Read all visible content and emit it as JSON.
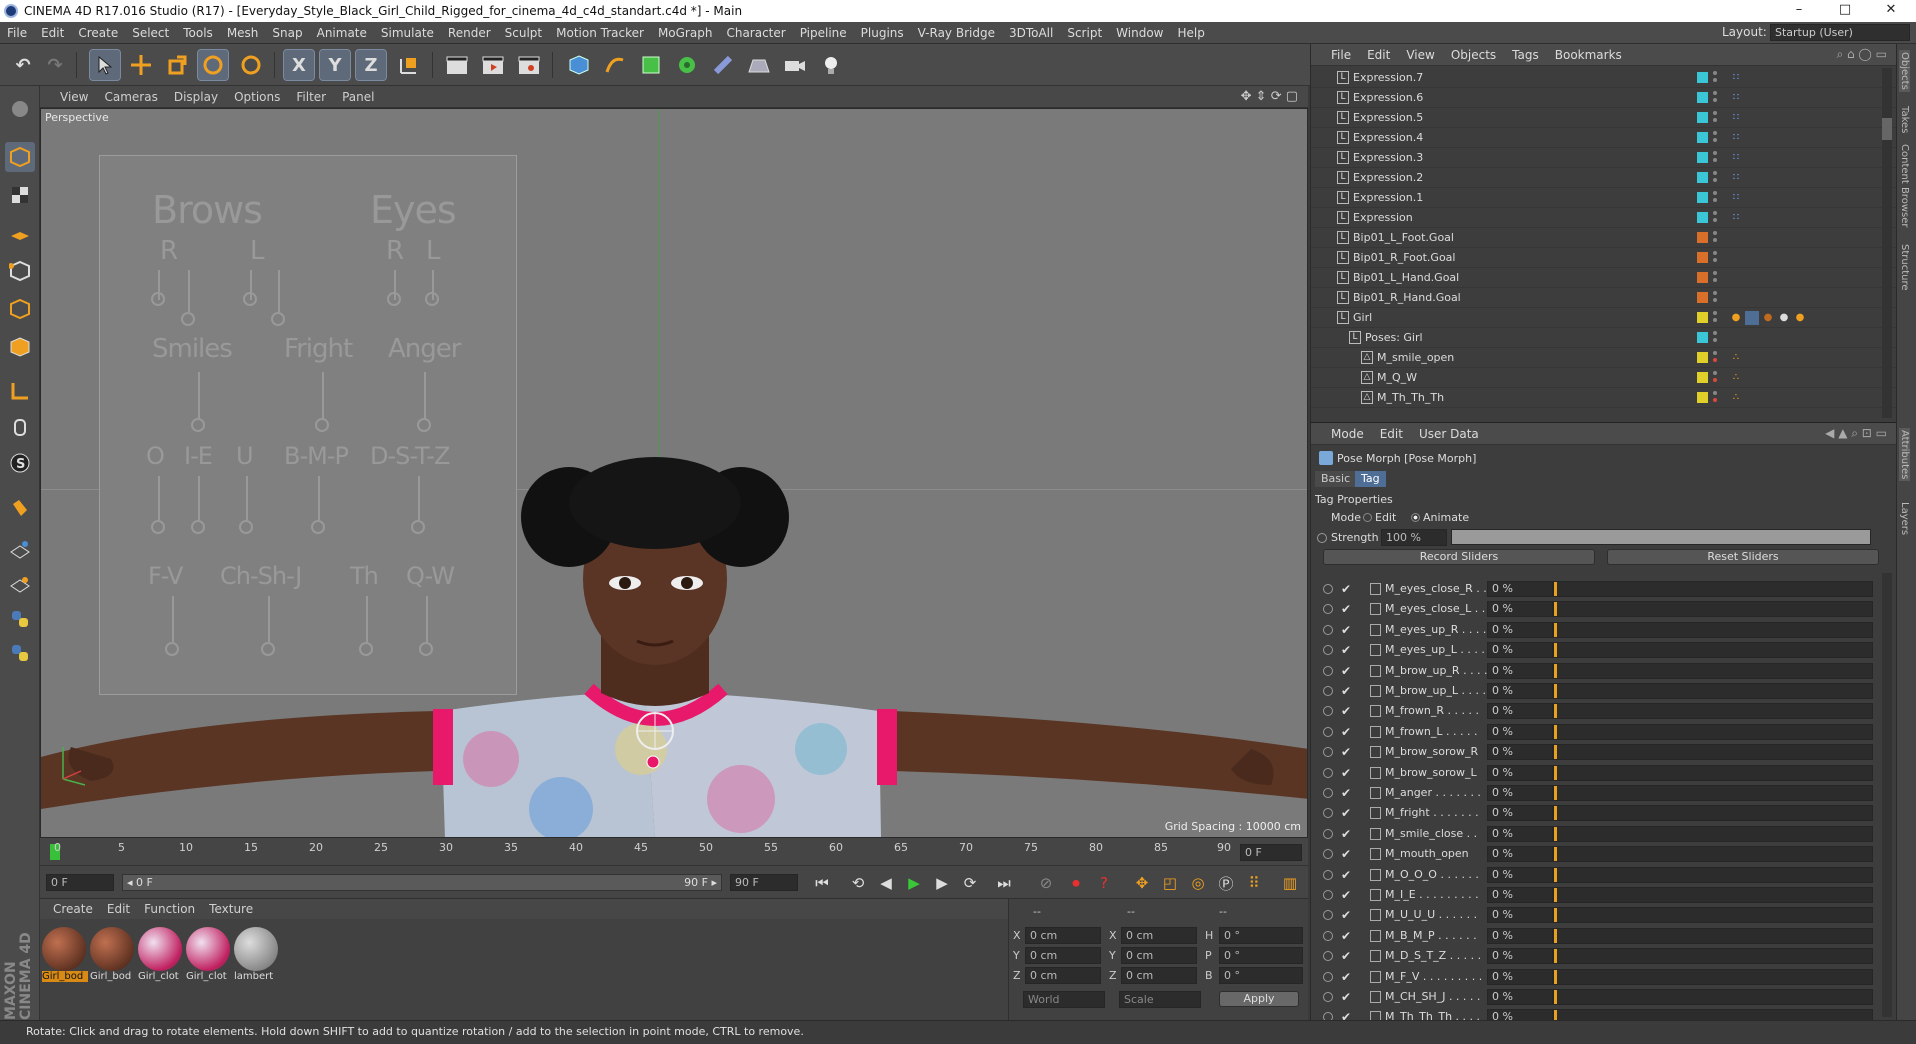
{
  "window": {
    "title": "CINEMA 4D R17.016 Studio (R17) - [Everyday_Style_Black_Girl_Child_Rigged_for_cinema_4d_c4d_standart.c4d *] - Main",
    "minimize": "–",
    "maximize": "□",
    "close": "✕"
  },
  "menubar": {
    "items": [
      "File",
      "Edit",
      "Create",
      "Select",
      "Tools",
      "Mesh",
      "Snap",
      "Animate",
      "Simulate",
      "Render",
      "Sculpt",
      "Motion Tracker",
      "MoGraph",
      "Character",
      "Pipeline",
      "Plugins",
      "V-Ray Bridge",
      "3DToAll",
      "Script",
      "Window",
      "Help"
    ],
    "layout_label": "Layout:",
    "layout_value": "Startup (User)"
  },
  "toolbar": {
    "undo": "↶",
    "redo": "↷",
    "x": "X",
    "y": "Y",
    "z": "Z"
  },
  "viewport": {
    "menu": [
      "View",
      "Cameras",
      "Display",
      "Options",
      "Filter",
      "Panel"
    ],
    "label": "Perspective",
    "grid_spacing": "Grid Spacing : 10000 cm",
    "face_panel": {
      "brows": "Brows",
      "eyes": "Eyes",
      "r": "R",
      "l": "L",
      "smiles": "Smiles",
      "fright": "Fright",
      "anger": "Anger",
      "o": "O",
      "ie": "I-E",
      "u": "U",
      "bmp": "B-M-P",
      "dstz": "D-S-T-Z",
      "fv": "F-V",
      "chshj": "Ch-Sh-J",
      "th": "Th",
      "qw": "Q-W"
    }
  },
  "timeline": {
    "ticks": [
      "0",
      "5",
      "10",
      "15",
      "20",
      "25",
      "30",
      "35",
      "40",
      "45",
      "50",
      "55",
      "60",
      "65",
      "70",
      "75",
      "80",
      "85",
      "90"
    ],
    "current_frame": "0 F"
  },
  "playback": {
    "start": "0 F",
    "range_start": "◂ 0 F",
    "range_end": "90 F ▸",
    "end": "90 F"
  },
  "materials": {
    "menu": [
      "Create",
      "Edit",
      "Function",
      "Texture"
    ],
    "items": [
      {
        "label": "Girl_bod",
        "color": "#7a3a22"
      },
      {
        "label": "Girl_bod",
        "color": "#7a3a22"
      },
      {
        "label": "Girl_clot",
        "color": "#c8a0b8"
      },
      {
        "label": "Girl_clot",
        "color": "#c8a0b8"
      },
      {
        "label": "lambert",
        "color": "#9a9a9a"
      }
    ]
  },
  "coords": {
    "header": [
      "--",
      "--",
      "--"
    ],
    "rows": [
      {
        "a": "X",
        "av": "0 cm",
        "b": "X",
        "bv": "0 cm",
        "c": "H",
        "cv": "0 °"
      },
      {
        "a": "Y",
        "av": "0 cm",
        "b": "Y",
        "bv": "0 cm",
        "c": "P",
        "cv": "0 °"
      },
      {
        "a": "Z",
        "av": "0 cm",
        "b": "Z",
        "bv": "0 cm",
        "c": "B",
        "cv": "0 °"
      }
    ],
    "world": "World",
    "scale": "Scale",
    "apply": "Apply"
  },
  "objects": {
    "menu": [
      "File",
      "Edit",
      "View",
      "Objects",
      "Tags",
      "Bookmarks"
    ],
    "items": [
      {
        "name": "Expression.7",
        "indent": 1,
        "color": "#3ac6d6",
        "tag": "exp"
      },
      {
        "name": "Expression.6",
        "indent": 1,
        "color": "#3ac6d6",
        "tag": "exp"
      },
      {
        "name": "Expression.5",
        "indent": 1,
        "color": "#3ac6d6",
        "tag": "exp"
      },
      {
        "name": "Expression.4",
        "indent": 1,
        "color": "#3ac6d6",
        "tag": "exp"
      },
      {
        "name": "Expression.3",
        "indent": 1,
        "color": "#3ac6d6",
        "tag": "exp"
      },
      {
        "name": "Expression.2",
        "indent": 1,
        "color": "#3ac6d6",
        "tag": "exp"
      },
      {
        "name": "Expression.1",
        "indent": 1,
        "color": "#3ac6d6",
        "tag": "exp"
      },
      {
        "name": "Expression",
        "indent": 1,
        "color": "#3ac6d6",
        "tag": "exp"
      },
      {
        "name": "Bip01_L_Foot.Goal",
        "indent": 1,
        "color": "#d8702a",
        "tag": ""
      },
      {
        "name": "Bip01_R_Foot.Goal",
        "indent": 1,
        "color": "#d8702a",
        "tag": ""
      },
      {
        "name": "Bip01_L_Hand.Goal",
        "indent": 1,
        "color": "#d8702a",
        "tag": ""
      },
      {
        "name": "Bip01_R_Hand.Goal",
        "indent": 1,
        "color": "#d8702a",
        "tag": ""
      },
      {
        "name": "Girl",
        "indent": 1,
        "color": "#e2d02a",
        "tag": "multi"
      },
      {
        "name": "Poses: Girl",
        "indent": 2,
        "color": "#3ac6d6",
        "tag": ""
      },
      {
        "name": "M_smile_open",
        "indent": 3,
        "color": "#e2d02a",
        "tag": "pose"
      },
      {
        "name": "M_Q_W",
        "indent": 3,
        "color": "#e2d02a",
        "tag": "pose"
      },
      {
        "name": "M_Th_Th_Th",
        "indent": 3,
        "color": "#e2d02a",
        "tag": "pose"
      }
    ]
  },
  "attributes": {
    "menu": [
      "Mode",
      "Edit",
      "User Data"
    ],
    "title": "Pose Morph [Pose Morph]",
    "tabs": [
      "Basic",
      "Tag"
    ],
    "section": "Tag Properties",
    "mode_label": "Mode",
    "mode_edit": "Edit",
    "mode_animate": "Animate",
    "strength_label": "Strength",
    "strength_value": "100 %",
    "strength_fraction": 1.0,
    "record": "Record Sliders",
    "reset": "Reset Sliders",
    "sliders": [
      {
        "name": "M_eyes_close_R . .",
        "value": "0 %"
      },
      {
        "name": "M_eyes_close_L . .",
        "value": "0 %"
      },
      {
        "name": "M_eyes_up_R . . . .",
        "value": "0 %"
      },
      {
        "name": "M_eyes_up_L . . . .",
        "value": "0 %"
      },
      {
        "name": "M_brow_up_R . . . .",
        "value": "0 %"
      },
      {
        "name": "M_brow_up_L . . . .",
        "value": "0 %"
      },
      {
        "name": "M_frown_R . . . . .",
        "value": "0 %"
      },
      {
        "name": "M_frown_L . . . . .",
        "value": "0 %"
      },
      {
        "name": "M_brow_sorow_R",
        "value": "0 %"
      },
      {
        "name": "M_brow_sorow_L",
        "value": "0 %"
      },
      {
        "name": "M_anger . . . . . . .",
        "value": "0 %"
      },
      {
        "name": "M_fright . . . . . . .",
        "value": "0 %"
      },
      {
        "name": "M_smile_close . .",
        "value": "0 %"
      },
      {
        "name": "M_mouth_open",
        "value": "0 %"
      },
      {
        "name": "M_O_O_O . . . . . .",
        "value": "0 %"
      },
      {
        "name": "M_I_E . . . . . . . . .",
        "value": "0 %"
      },
      {
        "name": "M_U_U_U . . . . . .",
        "value": "0 %"
      },
      {
        "name": "M_B_M_P . . . . . .",
        "value": "0 %"
      },
      {
        "name": "M_D_S_T_Z . . . . .",
        "value": "0 %"
      },
      {
        "name": "M_F_V . . . . . . . . .",
        "value": "0 %"
      },
      {
        "name": "M_CH_SH_J . . . . .",
        "value": "0 %"
      },
      {
        "name": "M_Th_Th_Th . . . .",
        "value": "0 %"
      }
    ]
  },
  "side_tabs": [
    "Objects",
    "Takes",
    "Content Browser",
    "Structure",
    "Attributes",
    "Layers"
  ],
  "brand": "MAXON CINEMA 4D",
  "status": "Rotate: Click and drag to rotate elements. Hold down SHIFT to add to quantize rotation / add to the selection in point mode, CTRL to remove."
}
